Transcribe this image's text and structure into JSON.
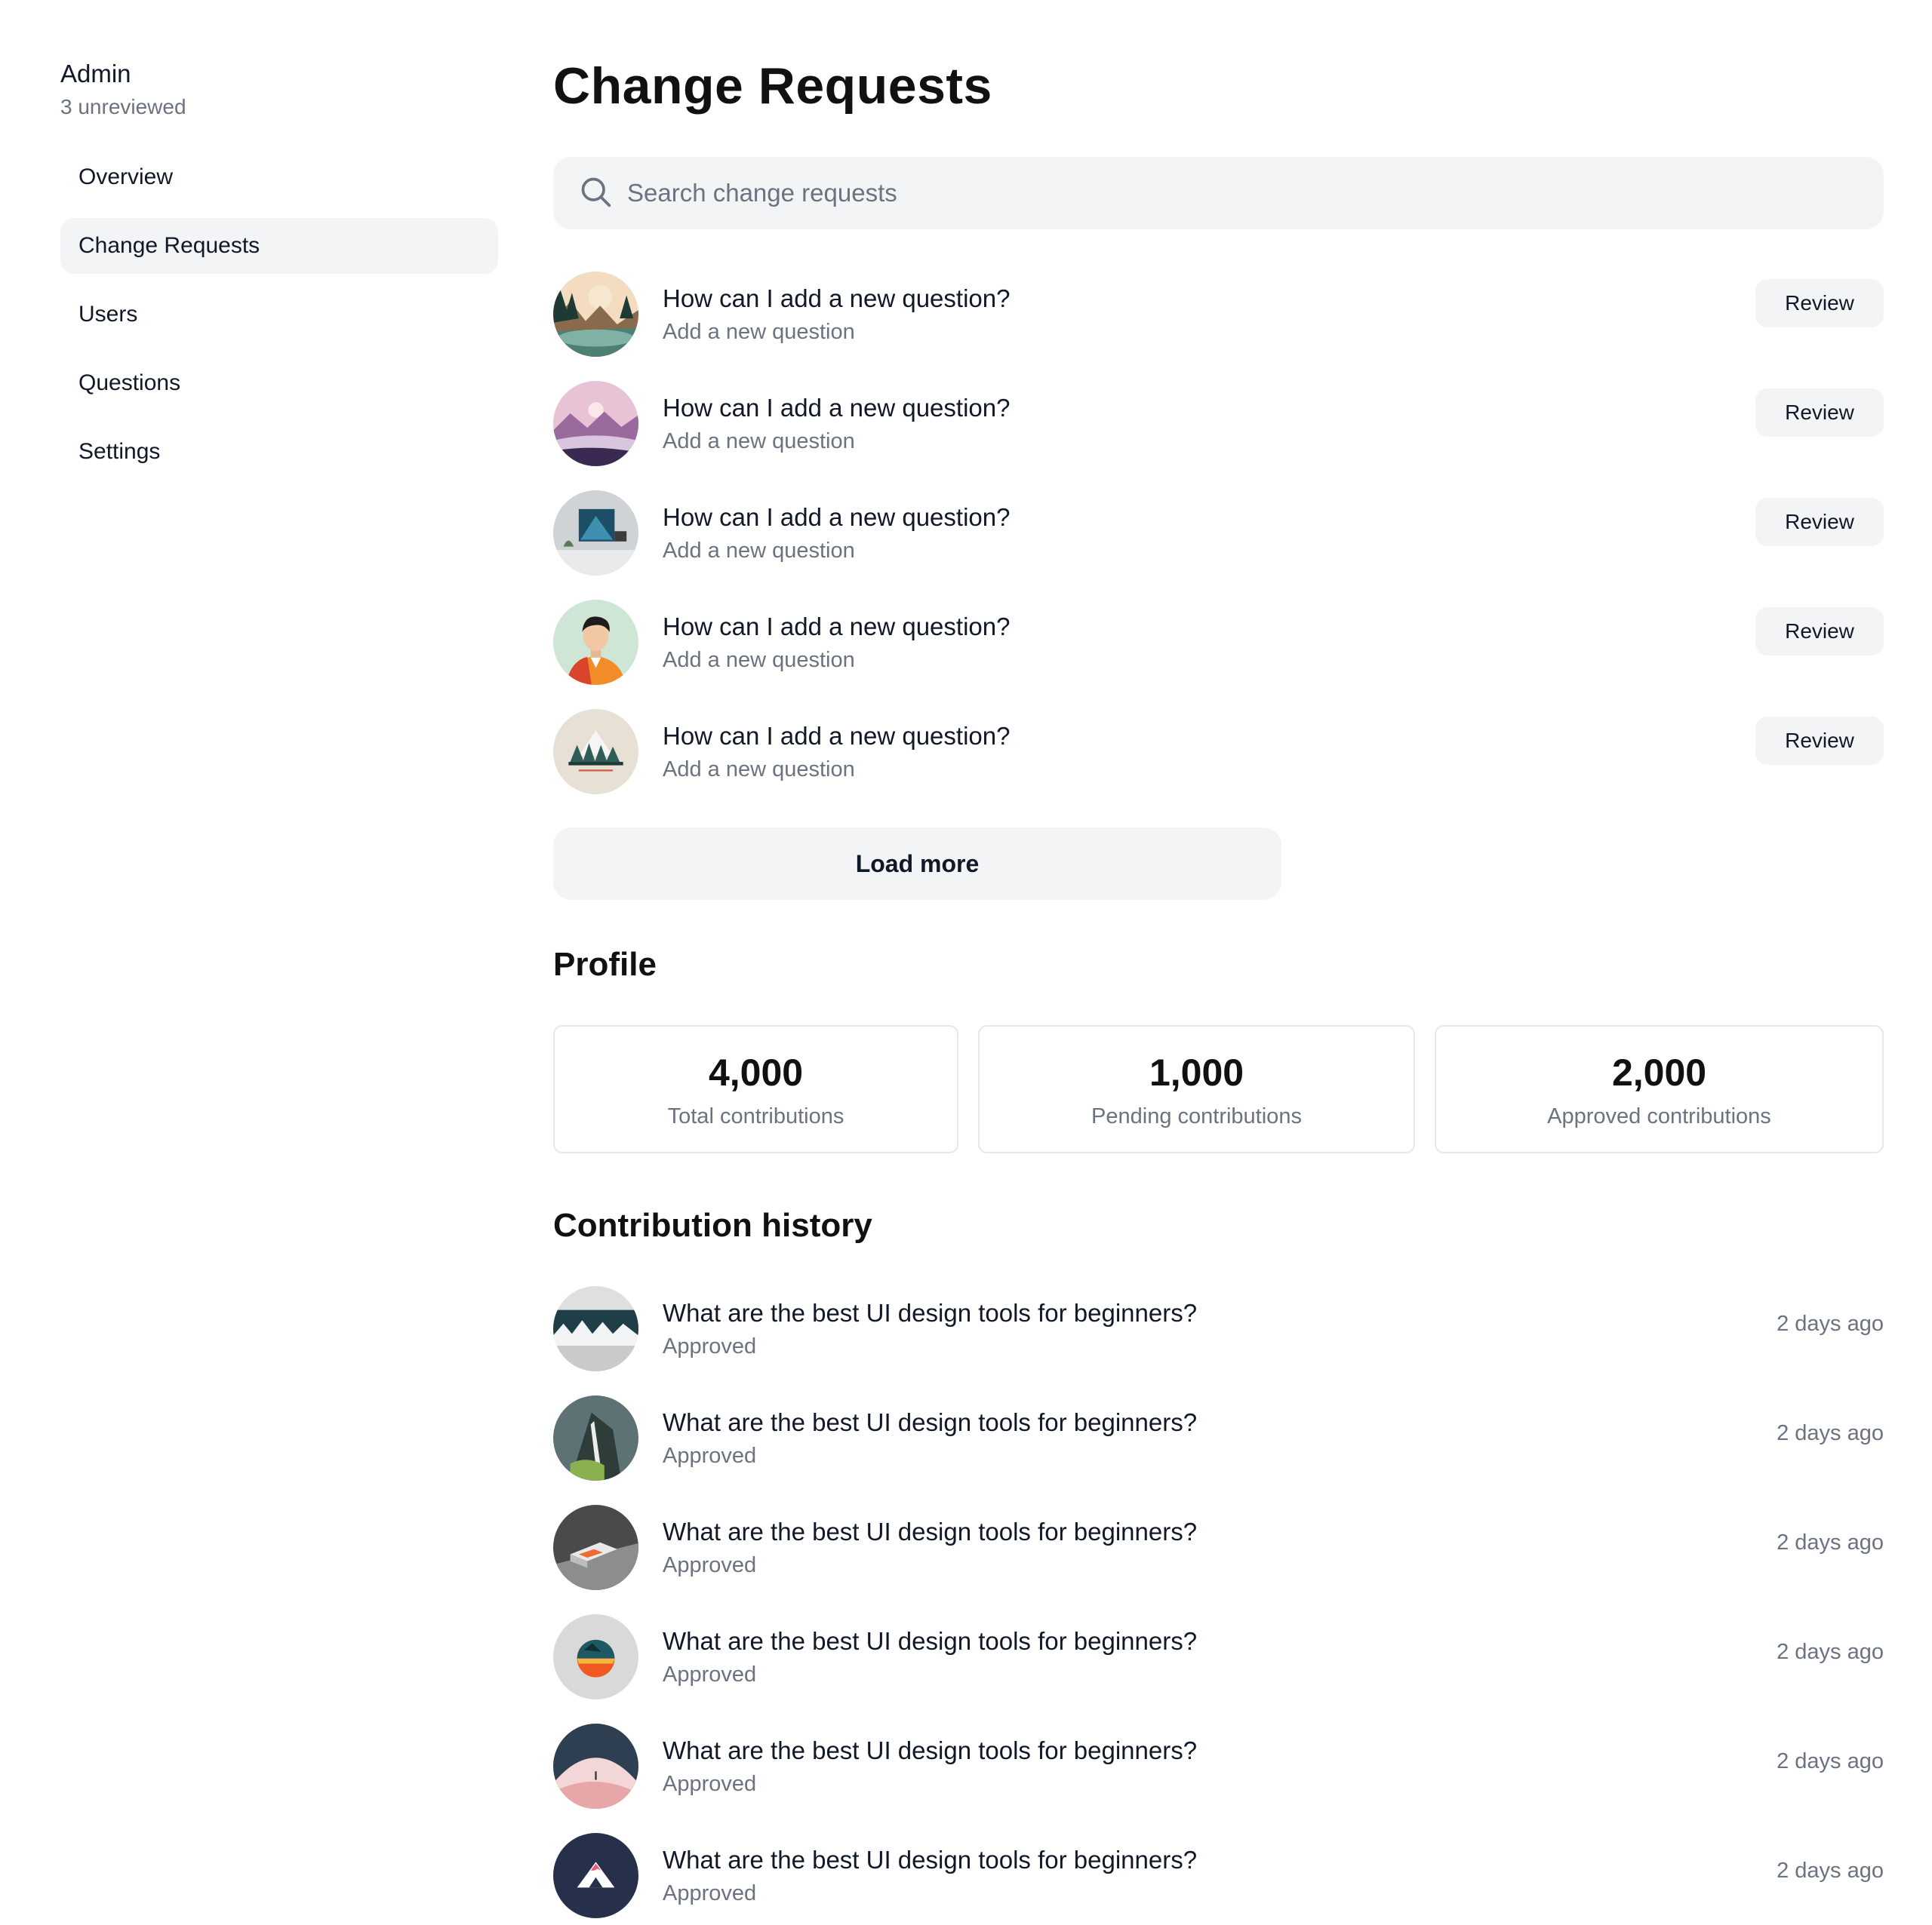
{
  "sidebar": {
    "title": "Admin",
    "subtitle": "3 unreviewed",
    "items": [
      {
        "label": "Overview",
        "active": false
      },
      {
        "label": "Change Requests",
        "active": true
      },
      {
        "label": "Users",
        "active": false
      },
      {
        "label": "Questions",
        "active": false
      },
      {
        "label": "Settings",
        "active": false
      }
    ]
  },
  "main": {
    "title": "Change Requests",
    "search": {
      "placeholder": "Search change requests",
      "value": ""
    },
    "requests": [
      {
        "title": "How can I add a new question?",
        "subtitle": "Add a new question",
        "action": "Review",
        "avatar": "lake-landscape-image"
      },
      {
        "title": "How can I add a new question?",
        "subtitle": "Add a new question",
        "action": "Review",
        "avatar": "purple-mountains-image"
      },
      {
        "title": "How can I add a new question?",
        "subtitle": "Add a new question",
        "action": "Review",
        "avatar": "interior-room-image"
      },
      {
        "title": "How can I add a new question?",
        "subtitle": "Add a new question",
        "action": "Review",
        "avatar": "person-portrait-image"
      },
      {
        "title": "How can I add a new question?",
        "subtitle": "Add a new question",
        "action": "Review",
        "avatar": "snowy-forest-image"
      }
    ],
    "load_more": "Load more"
  },
  "profile": {
    "title": "Profile",
    "stats": [
      {
        "value": "4,000",
        "label": "Total contributions"
      },
      {
        "value": "1,000",
        "label": "Pending contributions"
      },
      {
        "value": "2,000",
        "label": "Approved contributions"
      }
    ]
  },
  "history": {
    "title": "Contribution history",
    "items": [
      {
        "title": "What are the best UI design tools for beginners?",
        "status": "Approved",
        "time": "2 days ago",
        "avatar": "icy-mountains-image"
      },
      {
        "title": "What are the best UI design tools for beginners?",
        "status": "Approved",
        "time": "2 days ago",
        "avatar": "waterfall-cliff-image"
      },
      {
        "title": "What are the best UI design tools for beginners?",
        "status": "Approved",
        "time": "2 days ago",
        "avatar": "abstract-3d-image"
      },
      {
        "title": "What are the best UI design tools for beginners?",
        "status": "Approved",
        "time": "2 days ago",
        "avatar": "sunset-sphere-image"
      },
      {
        "title": "What are the best UI design tools for beginners?",
        "status": "Approved",
        "time": "2 days ago",
        "avatar": "pink-dune-image"
      },
      {
        "title": "What are the best UI design tools for beginners?",
        "status": "Approved",
        "time": "2 days ago",
        "avatar": "navy-mountain-logo-image"
      }
    ]
  },
  "colors": {
    "text": "#111827",
    "muted": "#6b7280",
    "surface": "#f3f4f6",
    "border": "#e5e7eb"
  }
}
